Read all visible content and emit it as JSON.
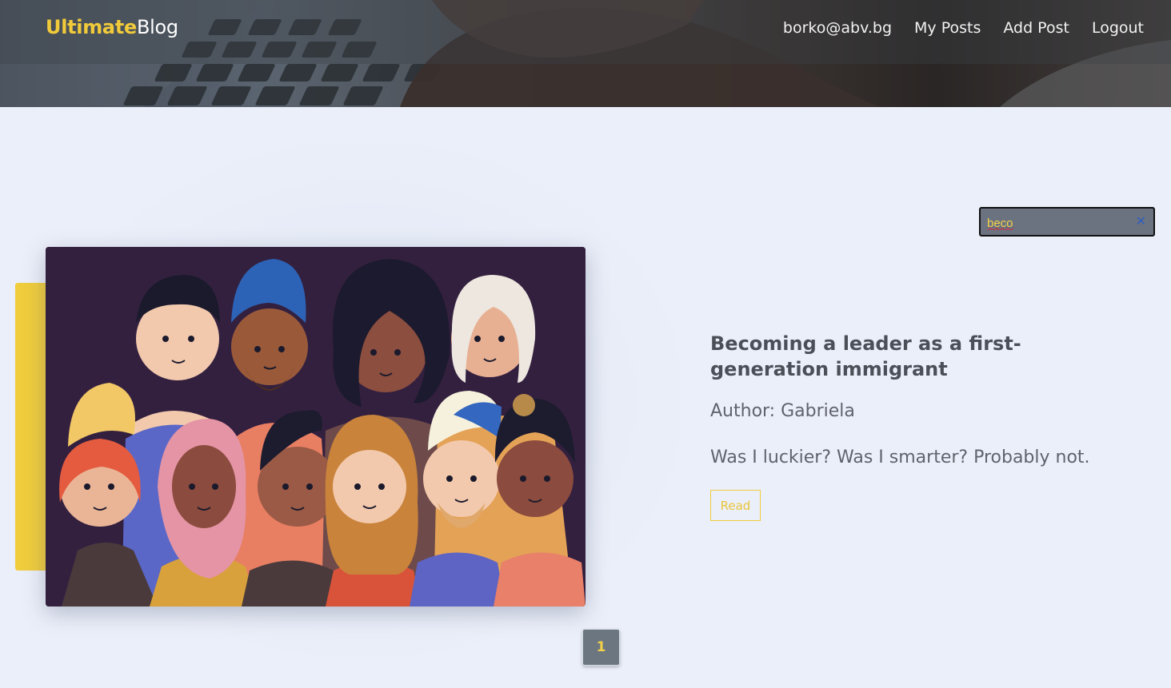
{
  "brand": {
    "part1": "Ultimate",
    "part2": "Blog"
  },
  "nav": {
    "user_email": "borko@abv.bg",
    "my_posts": "My Posts",
    "add_post": "Add Post",
    "logout": "Logout"
  },
  "search": {
    "value": "beco",
    "clear_icon": "close-icon"
  },
  "post": {
    "title": "Becoming a leader as a first-generation immigrant",
    "author": "Author: Gabriela",
    "excerpt": "Was I luckier? Was I smarter? Probably not.",
    "read_label": "Read"
  },
  "pagination": {
    "current": "1"
  },
  "colors": {
    "accent": "#f0cd3c",
    "background": "#ebeff9",
    "text": "#4b4f58"
  }
}
